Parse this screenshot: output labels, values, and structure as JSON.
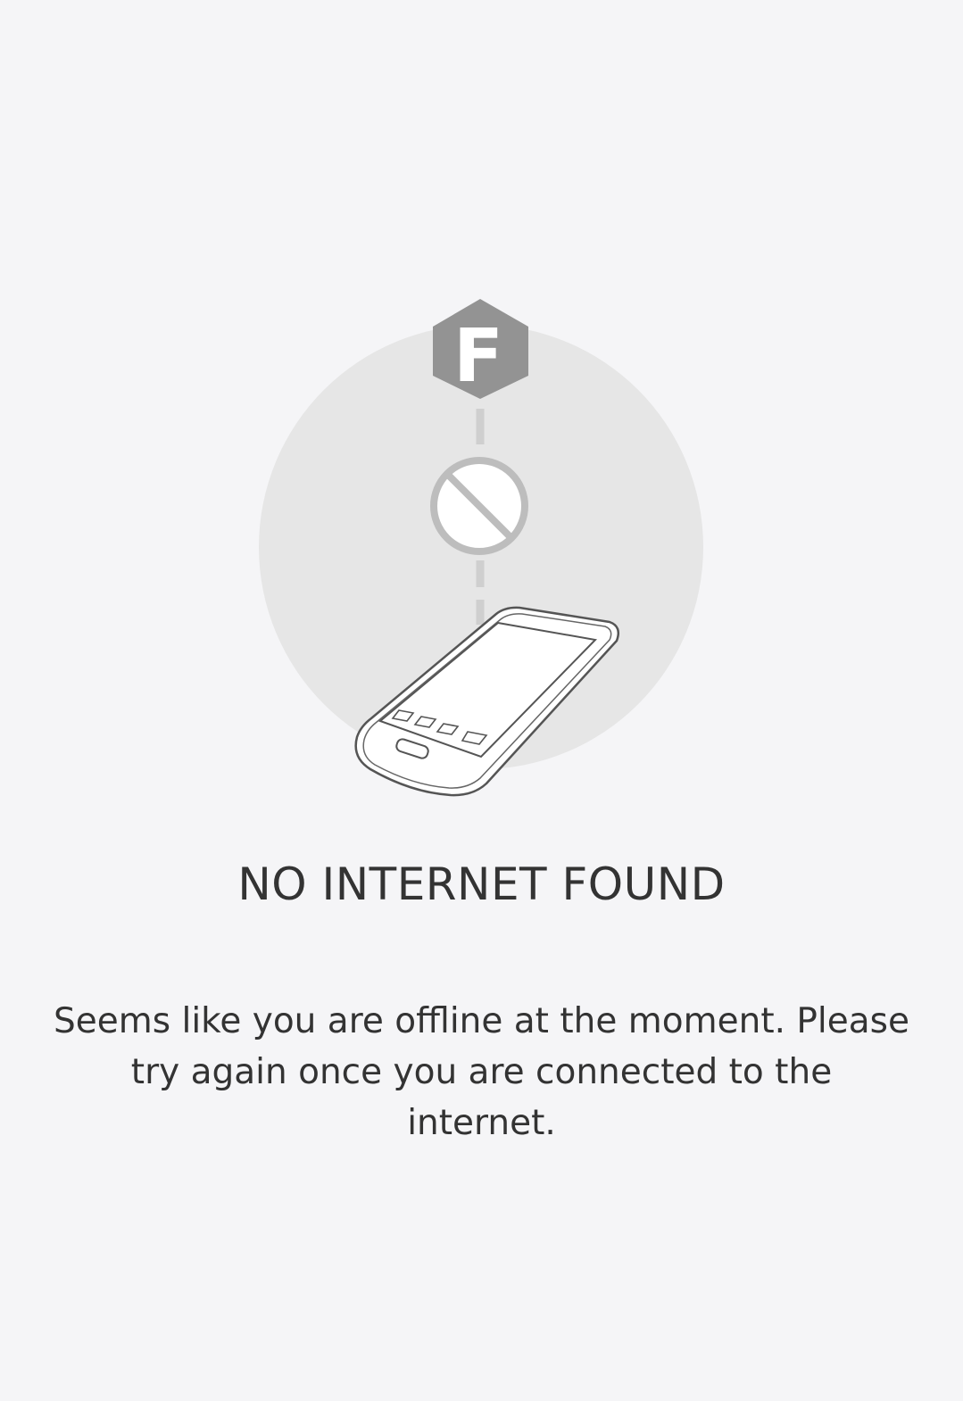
{
  "brand": {
    "logo_letter": "F",
    "logo_color": "#939393"
  },
  "illustration": {
    "icons": [
      "hexagon-logo-icon",
      "no-connection-icon",
      "smartphone-icon"
    ],
    "circle_color": "#e6e6e6",
    "connector_color": "#cfcfcf"
  },
  "error": {
    "title": "NO INTERNET FOUND",
    "message": "Seems like you are offline at the moment. Please try again once you are connected to the internet."
  },
  "colors": {
    "background": "#f5f5f7",
    "text": "#333333"
  }
}
